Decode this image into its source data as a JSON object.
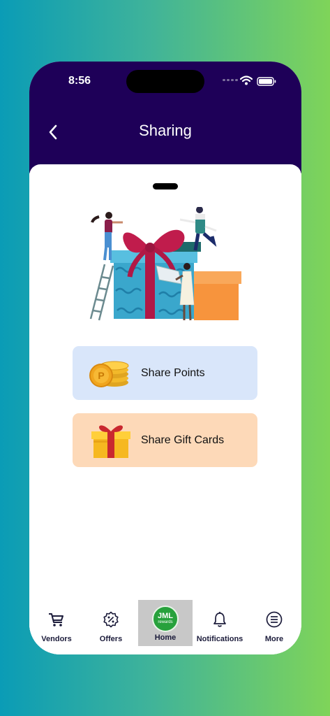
{
  "status_bar": {
    "time": "8:56"
  },
  "header": {
    "title": "Sharing"
  },
  "options": [
    {
      "label": "Share Points",
      "icon": "coins-icon"
    },
    {
      "label": "Share Gift Cards",
      "icon": "gift-box-icon"
    }
  ],
  "logo": {
    "line1": "JML",
    "line2": "rewards"
  },
  "tabbar": {
    "active": "Home",
    "items": [
      {
        "label": "Vendors",
        "icon": "cart-icon"
      },
      {
        "label": "Offers",
        "icon": "percent-badge-icon"
      },
      {
        "label": "Home",
        "icon": "jml-rewards-logo"
      },
      {
        "label": "Notifications",
        "icon": "bell-icon"
      },
      {
        "label": "More",
        "icon": "menu-list-icon"
      }
    ]
  },
  "colors": {
    "header": "#1e0058",
    "share_points_bg": "#d9e6fa",
    "share_gift_cards_bg": "#fdd9b8",
    "logo_green": "#27a13c"
  }
}
